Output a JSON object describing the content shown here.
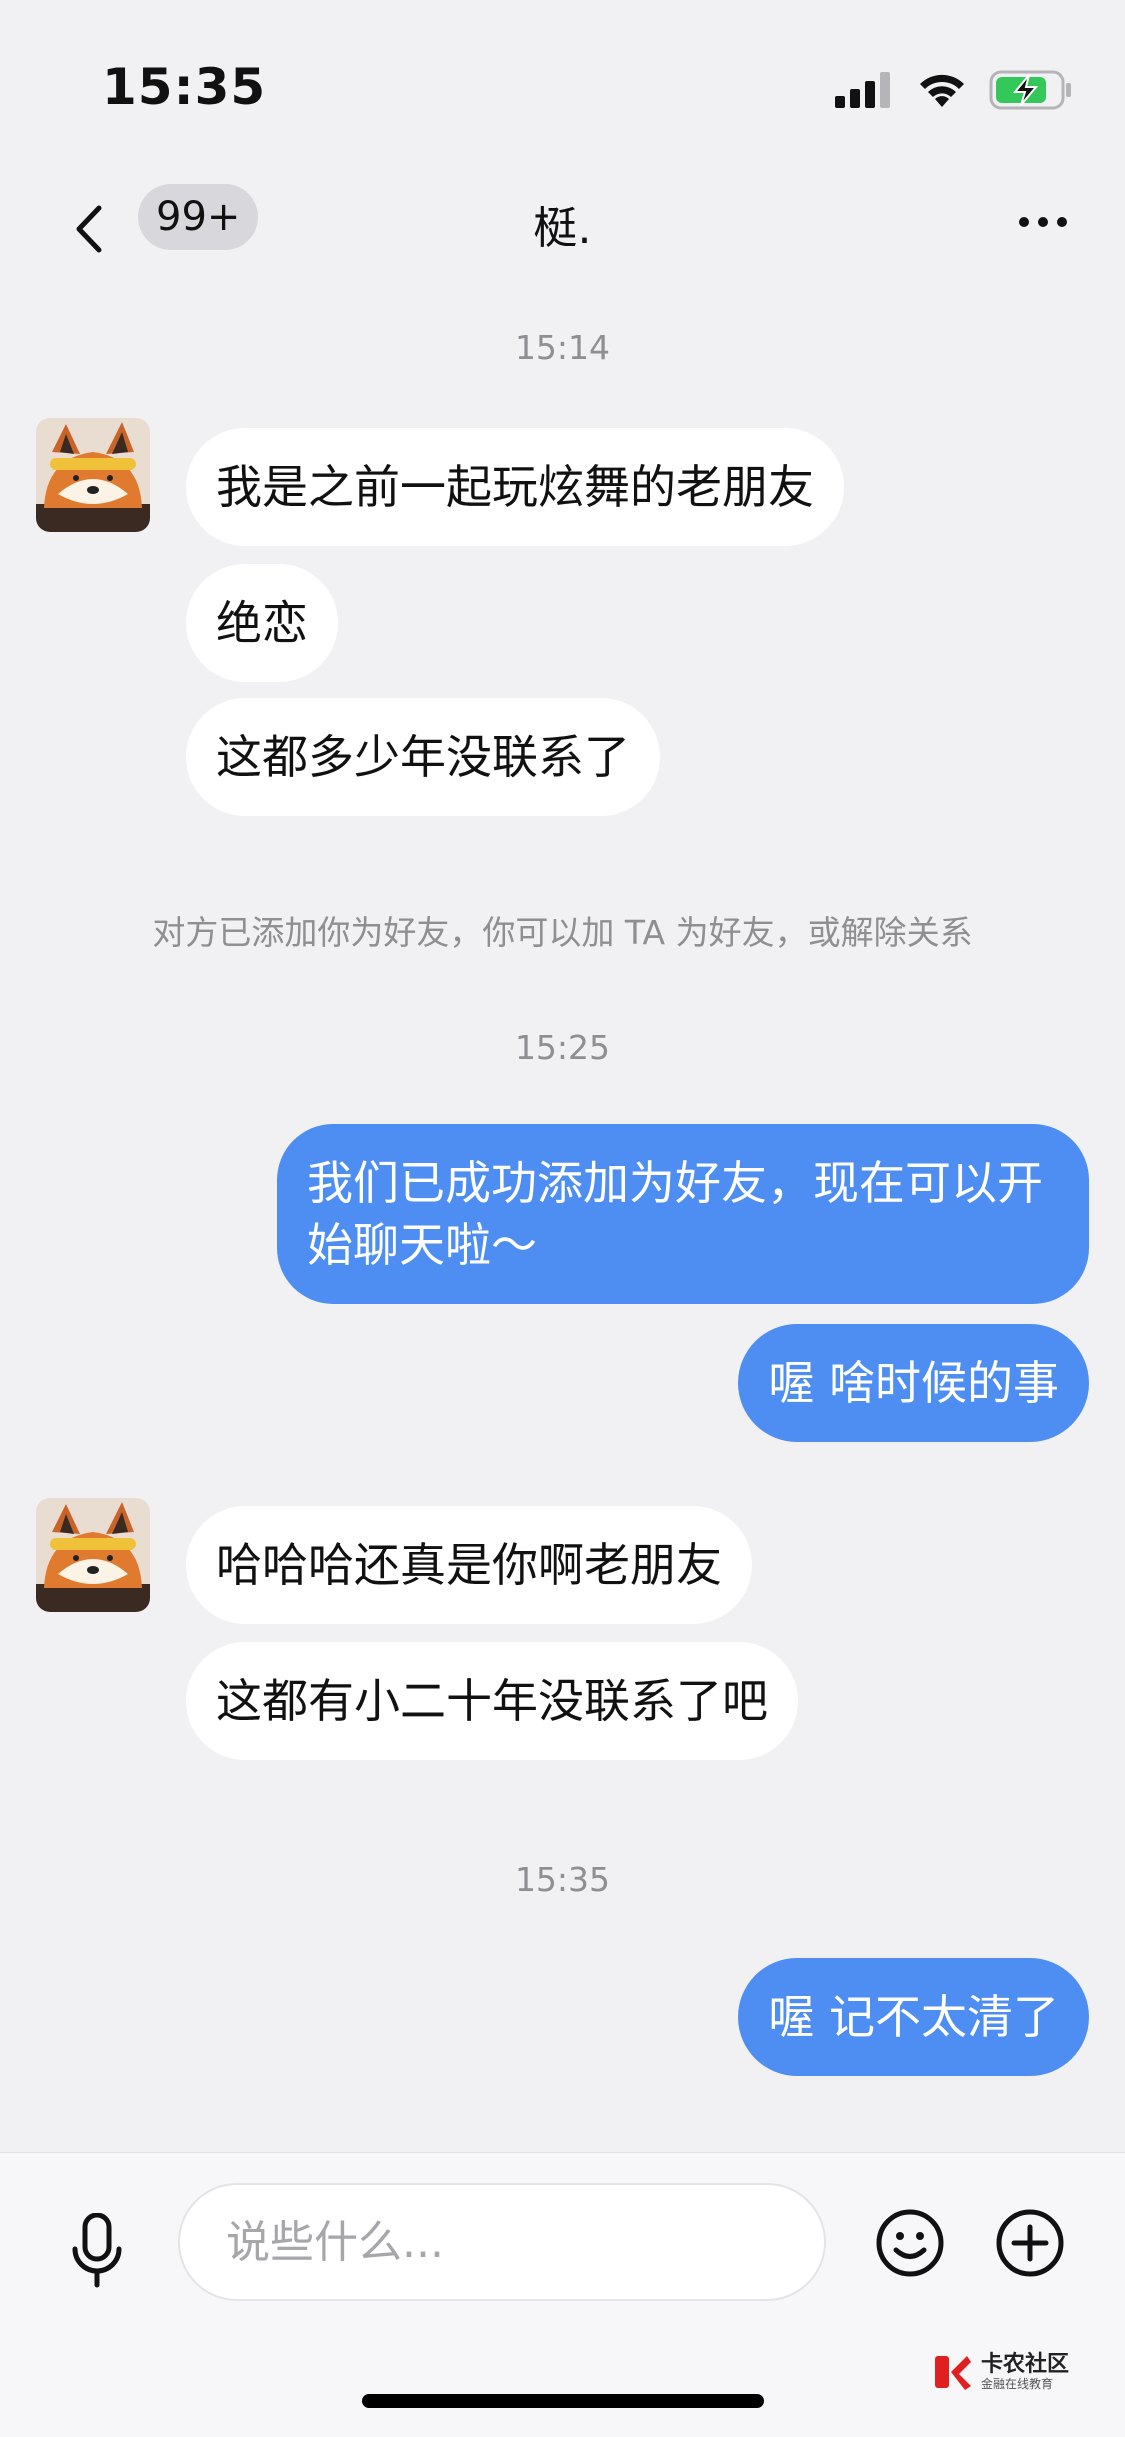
{
  "status": {
    "time": "15:35"
  },
  "nav": {
    "unread_badge": "99+",
    "title": "梃."
  },
  "messages": [
    {
      "type": "timestamp",
      "text": "15:14"
    },
    {
      "type": "in",
      "text": "我是之前一起玩炫舞的老朋友"
    },
    {
      "type": "in",
      "text": "绝恋"
    },
    {
      "type": "in",
      "text": "这都多少年没联系了"
    },
    {
      "type": "system",
      "text": "对方已添加你为好友，你可以加 TA 为好友，或解除关系"
    },
    {
      "type": "timestamp",
      "text": "15:25"
    },
    {
      "type": "out",
      "text": "我们已成功添加为好友，现在可以开始聊天啦～"
    },
    {
      "type": "out",
      "text": "喔  啥时候的事"
    },
    {
      "type": "in",
      "text": "哈哈哈还真是你啊老朋友"
    },
    {
      "type": "in",
      "text": "这都有小二十年没联系了吧"
    },
    {
      "type": "timestamp",
      "text": "15:35"
    },
    {
      "type": "out",
      "text": "喔 记不太清了"
    }
  ],
  "input": {
    "placeholder": "说些什么..."
  },
  "watermark": {
    "title": "卡农社区",
    "subtitle": "金融在线教育"
  },
  "colors": {
    "outgoing_bubble": "#4e8ef2",
    "incoming_bubble": "#ffffff",
    "background": "#f1f1f3",
    "battery": "#34c759"
  },
  "icons": [
    "back-arrow-icon",
    "more-dots-icon",
    "mic-icon",
    "emoji-icon",
    "plus-icon",
    "signal-icon",
    "wifi-icon",
    "battery-charging-icon"
  ]
}
